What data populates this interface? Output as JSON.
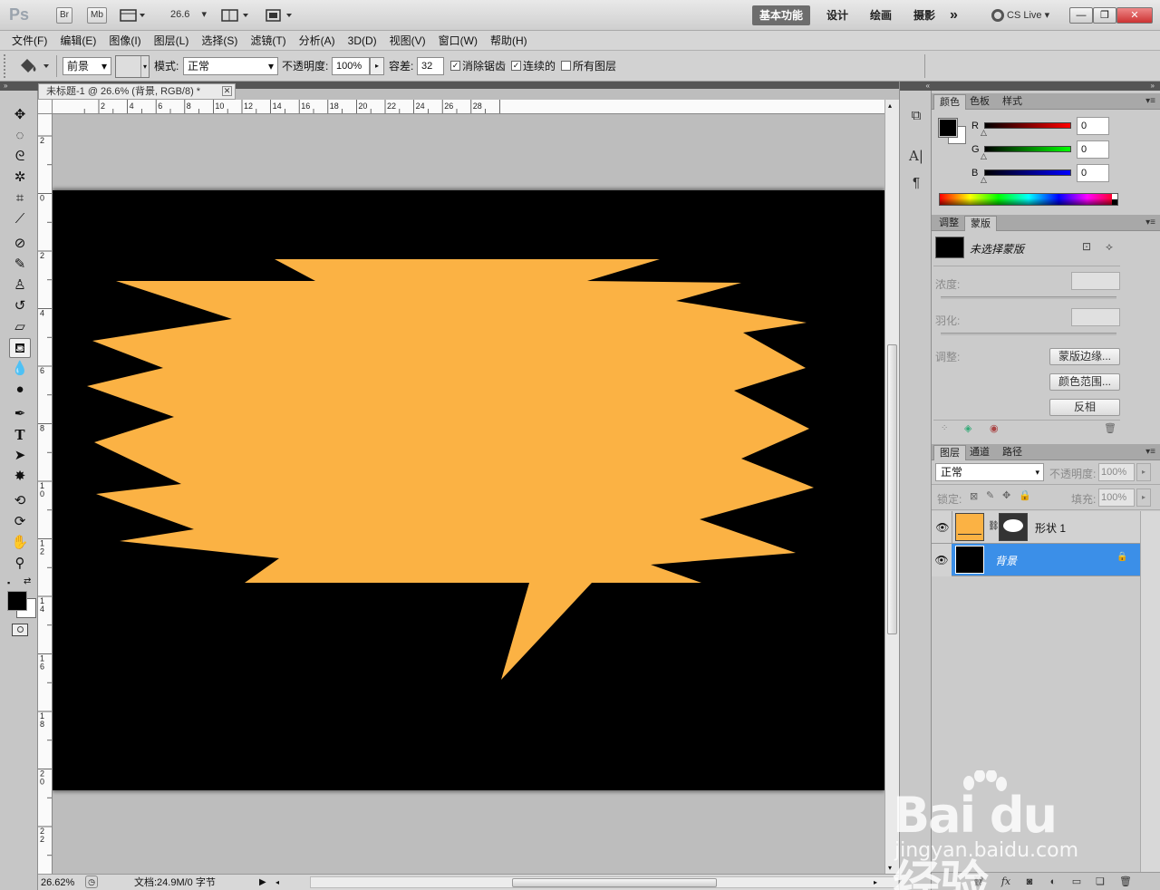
{
  "appbar": {
    "logo": "Ps",
    "bridge_btn": "Br",
    "minibridge_btn": "Mb",
    "zoom_value": "26.6",
    "workspaces": [
      "基本功能",
      "设计",
      "绘画",
      "摄影"
    ],
    "more": "»",
    "cslive": "CS Live",
    "win_min": "—",
    "win_restore": "❐",
    "win_close": "✕"
  },
  "menubar": [
    "文件(F)",
    "编辑(E)",
    "图像(I)",
    "图层(L)",
    "选择(S)",
    "滤镜(T)",
    "分析(A)",
    "3D(D)",
    "视图(V)",
    "窗口(W)",
    "帮助(H)"
  ],
  "options": {
    "fill_source": "前景",
    "mode_label": "模式:",
    "mode_value": "正常",
    "opacity_label": "不透明度:",
    "opacity_value": "100%",
    "tolerance_label": "容差:",
    "tolerance_value": "32",
    "antialias_label": "消除锯齿",
    "contiguous_label": "连续的",
    "all_layers_label": "所有图层",
    "antialias_checked": true,
    "contiguous_checked": true,
    "all_layers_checked": false
  },
  "document": {
    "tab_title": "未标题-1 @ 26.6% (背景, RGB/8) *",
    "ruler_top": [
      "2",
      "4",
      "6",
      "8",
      "10",
      "12",
      "14",
      "16",
      "18",
      "20",
      "22",
      "24",
      "26",
      "28"
    ],
    "ruler_left": [
      "2",
      "0",
      "2",
      "4",
      "6",
      "8",
      "1 0",
      "1 2",
      "1 4",
      "1 6",
      "1 8",
      "2 0",
      "2 2"
    ],
    "canvas_bg": "#000000",
    "shape_fill": "#fbb244"
  },
  "status": {
    "zoom": "26.62%",
    "doc_info": "文档:24.9M/0 字节"
  },
  "color_panel": {
    "tabs": [
      "颜色",
      "色板",
      "样式"
    ],
    "channels": [
      {
        "label": "R",
        "value": "0"
      },
      {
        "label": "G",
        "value": "0"
      },
      {
        "label": "B",
        "value": "0"
      }
    ]
  },
  "masks_panel": {
    "tabs": [
      "调整",
      "蒙版"
    ],
    "mask_title": "未选择蒙版",
    "density_label": "浓度:",
    "feather_label": "羽化:",
    "refine_label": "调整:",
    "mask_edge_btn": "蒙版边缘...",
    "color_range_btn": "颜色范围...",
    "invert_btn": "反相"
  },
  "layers_panel": {
    "tabs": [
      "图层",
      "通道",
      "路径"
    ],
    "blend_mode": "正常",
    "opacity_label": "不透明度:",
    "opacity_value": "100%",
    "lock_label": "锁定:",
    "fill_label": "填充:",
    "fill_value": "100%",
    "layers": [
      {
        "name": "形状 1",
        "selected": false
      },
      {
        "name": "背景",
        "selected": true
      }
    ]
  },
  "watermark": {
    "main": "Bai du 经验",
    "sub": "jingyan.baidu.com"
  }
}
